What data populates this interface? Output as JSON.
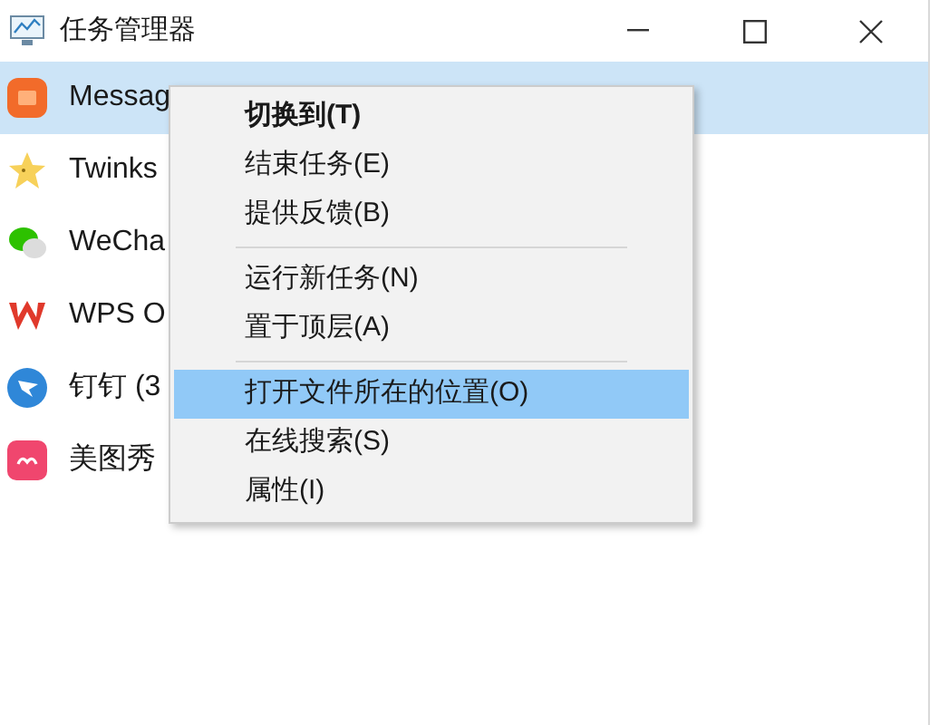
{
  "window": {
    "title": "任务管理器"
  },
  "apps": [
    {
      "name": "Messag",
      "selected": true
    },
    {
      "name": "Twinks",
      "selected": false
    },
    {
      "name": "WeCha",
      "selected": false
    },
    {
      "name": "WPS O",
      "selected": false
    },
    {
      "name": "钉钉 (3",
      "selected": false
    },
    {
      "name": "美图秀",
      "selected": false
    }
  ],
  "context_menu": {
    "groups": [
      [
        {
          "label": "切换到(T)",
          "default": true,
          "selected": false
        },
        {
          "label": "结束任务(E)",
          "default": false,
          "selected": false
        },
        {
          "label": "提供反馈(B)",
          "default": false,
          "selected": false
        }
      ],
      [
        {
          "label": "运行新任务(N)",
          "default": false,
          "selected": false
        },
        {
          "label": "置于顶层(A)",
          "default": false,
          "selected": false
        }
      ],
      [
        {
          "label": "打开文件所在的位置(O)",
          "default": false,
          "selected": true
        },
        {
          "label": "在线搜索(S)",
          "default": false,
          "selected": false
        },
        {
          "label": "属性(I)",
          "default": false,
          "selected": false
        }
      ]
    ]
  }
}
